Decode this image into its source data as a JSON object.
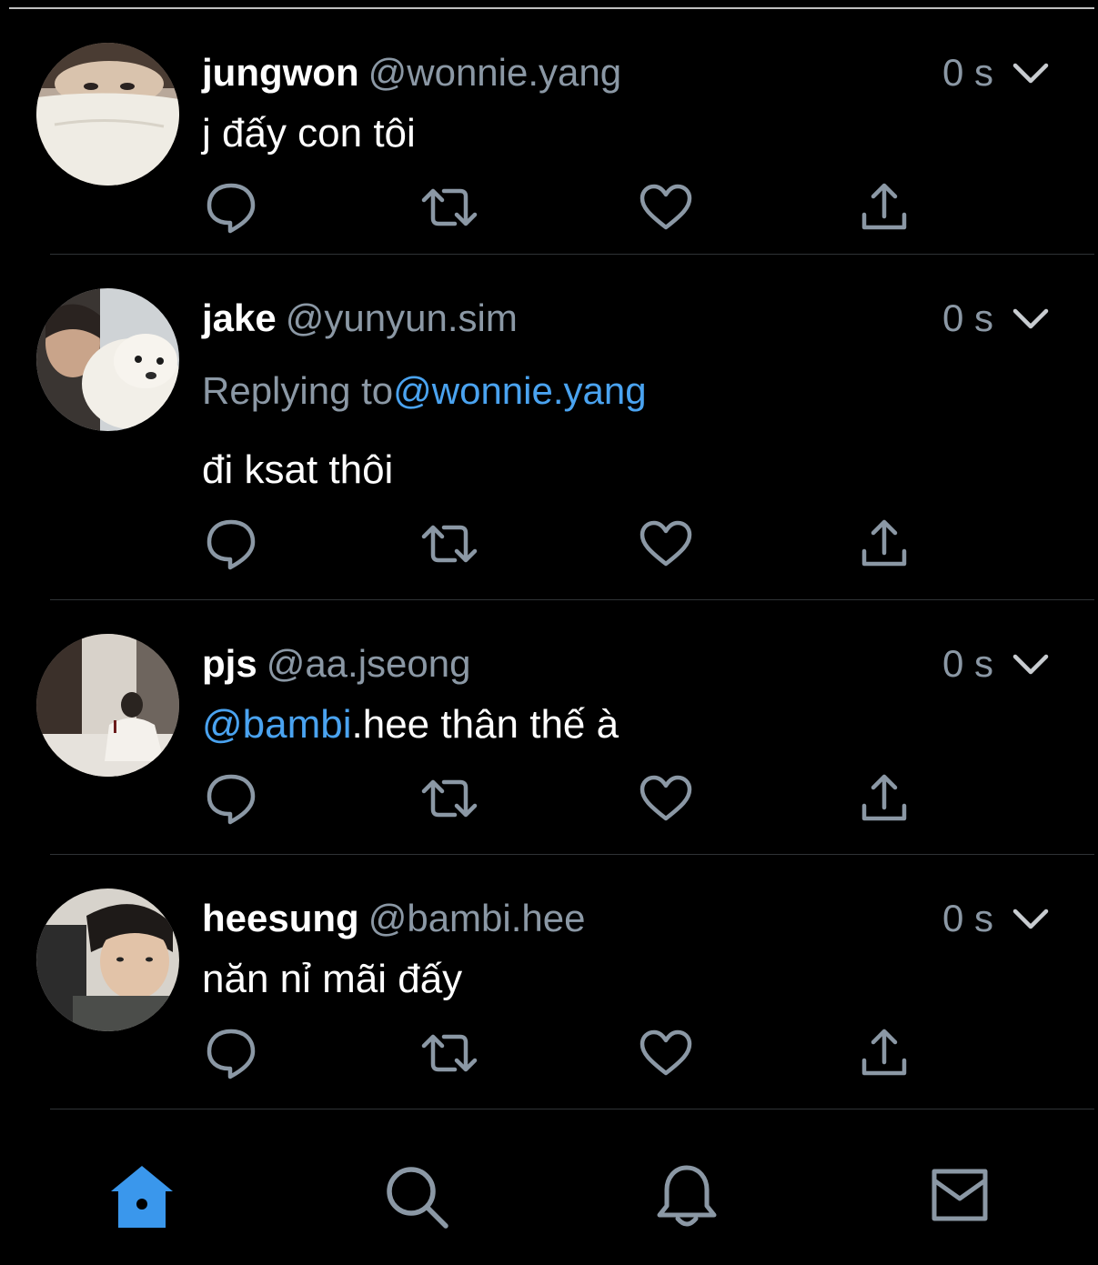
{
  "colors": {
    "background": "#000000",
    "text_primary": "#ffffff",
    "text_secondary": "#8b98a5",
    "accent": "#4aa3f0",
    "divider": "#2f3336"
  },
  "tweets": [
    {
      "display_name": "jungwon",
      "handle": "@wonnie.yang",
      "time": "0 s",
      "text": "j đấy con tôi"
    },
    {
      "display_name": "jake",
      "handle": "@yunyun.sim",
      "time": "0 s",
      "replying_prefix": "Replying to",
      "replying_to": "@wonnie.yang",
      "text": "đi ksat thôi"
    },
    {
      "display_name": "pjs",
      "handle": "@aa.jseong",
      "time": "0 s",
      "mention": "@bambi",
      "text": ".hee thân thế à"
    },
    {
      "display_name": "heesung",
      "handle": "@bambi.hee",
      "time": "0 s",
      "text": "năn nỉ mãi đấy"
    }
  ],
  "tweet_actions": [
    "reply-icon",
    "retweet-icon",
    "like-icon",
    "share-icon"
  ],
  "tab_bar": {
    "items": [
      "home-icon",
      "search-icon",
      "notifications-icon",
      "messages-icon"
    ],
    "active": "home-icon"
  }
}
